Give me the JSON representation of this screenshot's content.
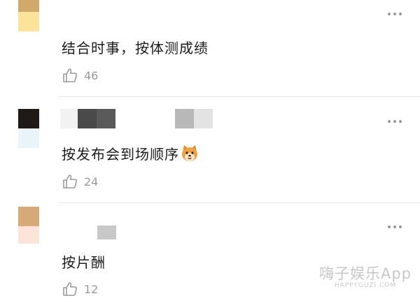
{
  "comments": [
    {
      "text": "结合时事，按体测成绩",
      "likes": "46"
    },
    {
      "text": "按发布会到场顺序",
      "emoji": "shiba-dog-emoji",
      "likes": "24"
    },
    {
      "text": "按片酬",
      "likes": "12"
    }
  ],
  "watermark": {
    "main": "嗨子娱乐App",
    "sub": "HAPPYGUZI.COM"
  },
  "colors": {
    "like_icon": "#9a9a9a",
    "divider": "#e6e6e6",
    "text": "#1c1c1c"
  }
}
